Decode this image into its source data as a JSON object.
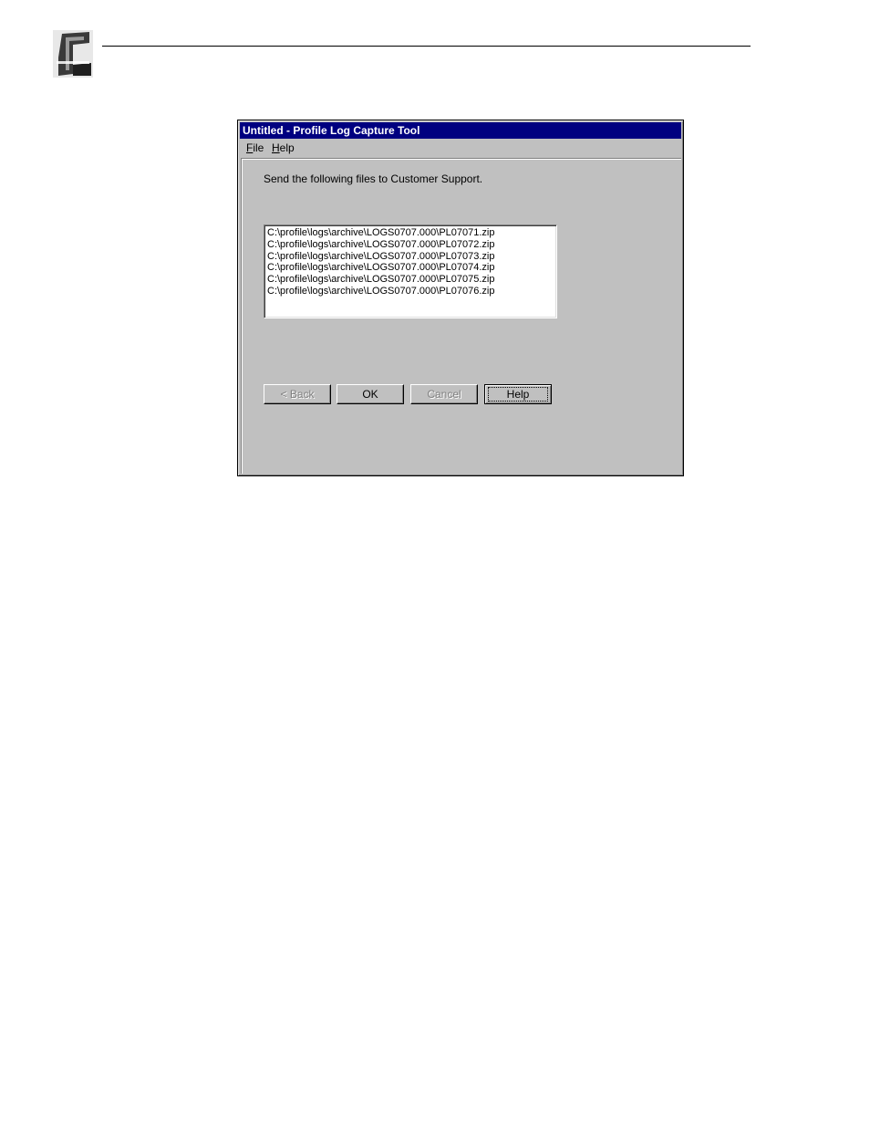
{
  "window": {
    "title": "Untitled - Profile Log Capture Tool",
    "menu": [
      {
        "underline": "F",
        "rest": "ile"
      },
      {
        "underline": "H",
        "rest": "elp"
      }
    ]
  },
  "content": {
    "instruction": "Send the following files to Customer Support.",
    "files": [
      "C:\\profile\\logs\\archive\\LOGS0707.000\\PL07071.zip",
      "C:\\profile\\logs\\archive\\LOGS0707.000\\PL07072.zip",
      "C:\\profile\\logs\\archive\\LOGS0707.000\\PL07073.zip",
      "C:\\profile\\logs\\archive\\LOGS0707.000\\PL07074.zip",
      "C:\\profile\\logs\\archive\\LOGS0707.000\\PL07075.zip",
      "C:\\profile\\logs\\archive\\LOGS0707.000\\PL07076.zip"
    ]
  },
  "buttons": {
    "back": "< Back",
    "ok": "OK",
    "cancel": "Cancel",
    "help": "Help"
  },
  "colors": {
    "titlebar": "#000080",
    "face": "#c0c0c0"
  }
}
